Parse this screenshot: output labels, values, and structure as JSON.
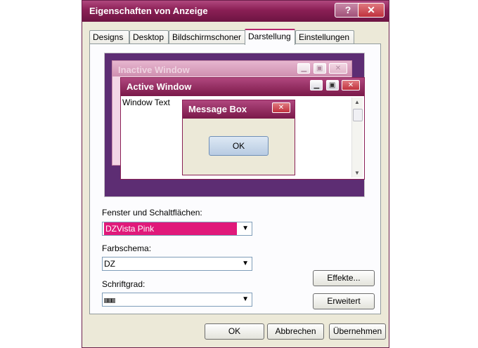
{
  "window": {
    "title": "Eigenschaften von Anzeige"
  },
  "titlebar": {
    "help_glyph": "?",
    "close_glyph": "✕"
  },
  "tabs": [
    {
      "label": "Designs"
    },
    {
      "label": "Desktop"
    },
    {
      "label": "Bildschirmschoner"
    },
    {
      "label": "Darstellung"
    },
    {
      "label": "Einstellungen"
    }
  ],
  "preview": {
    "inactive_title": "Inactive Window",
    "active_title": "Active Window",
    "window_text": "Window Text",
    "message_title": "Message Box",
    "ok_label": "OK",
    "min_glyph": "▁",
    "max_glyph": "▣",
    "close_glyph": "✕"
  },
  "fields": {
    "windows_label": "Fenster und Schaltflächen:",
    "windows_value": "DZVista Pink",
    "color_label": "Farbschema:",
    "color_value": "DZ",
    "font_label": "Schriftgrad:",
    "font_value": "▥▥▥"
  },
  "buttons": {
    "effects": "Effekte...",
    "advanced": "Erweitert",
    "ok": "OK",
    "cancel": "Abbrechen",
    "apply": "Übernehmen"
  },
  "colors": {
    "title_accent": "#8a1f55",
    "selection": "#e0197a",
    "preview_bg": "#5d2d73"
  }
}
